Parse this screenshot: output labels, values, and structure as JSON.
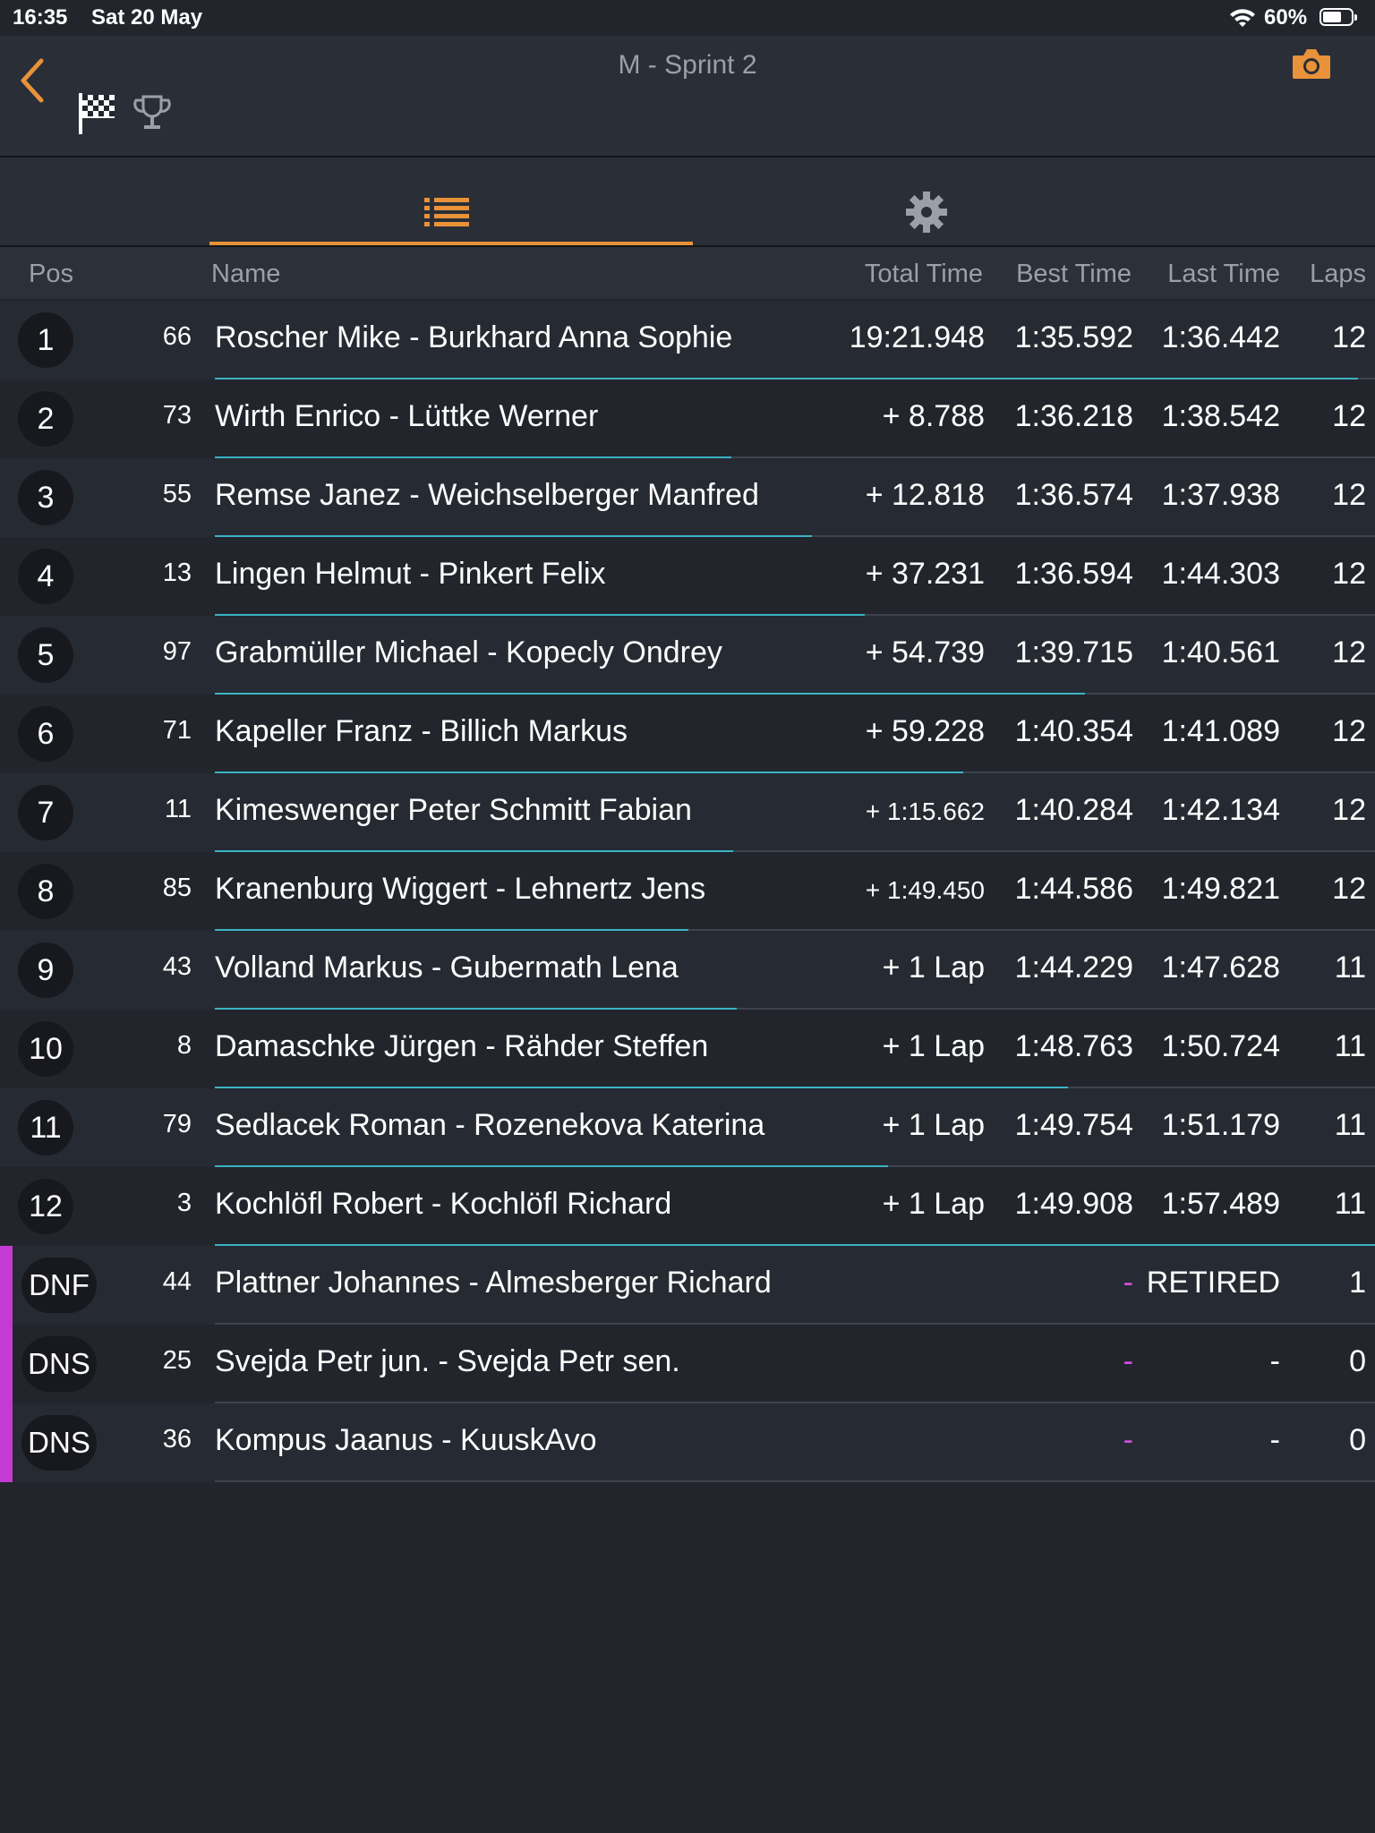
{
  "status": {
    "time": "16:35",
    "date": "Sat 20 May",
    "battery": "60%"
  },
  "nav": {
    "title": "M - Sprint 2"
  },
  "columns": {
    "pos": "Pos",
    "name": "Name",
    "total": "Total Time",
    "best": "Best Time",
    "last": "Last Time",
    "laps": "Laps"
  },
  "colors": {
    "accent": "#e8923a",
    "progress": "#3bb3c6",
    "retired": "#c43bd4"
  },
  "rows": [
    {
      "pos": "1",
      "num": "66",
      "name": "Roscher Mike - Burkhard Anna Sophie",
      "total": "19:21.948",
      "best": "1:35.592",
      "last": "1:36.442",
      "laps": "12",
      "progress": 0.985
    },
    {
      "pos": "2",
      "num": "73",
      "name": "Wirth  Enrico - Lüttke Werner",
      "total": "+ 8.788",
      "best": "1:36.218",
      "last": "1:38.542",
      "laps": "12",
      "progress": 0.445
    },
    {
      "pos": "3",
      "num": "55",
      "name": "Remse  Janez - Weichselberger Manfred",
      "total": "+ 12.818",
      "best": "1:36.574",
      "last": "1:37.938",
      "laps": "12",
      "progress": 0.515
    },
    {
      "pos": "4",
      "num": "13",
      "name": "Lingen  Helmut - Pinkert Felix",
      "total": "+ 37.231",
      "best": "1:36.594",
      "last": "1:44.303",
      "laps": "12",
      "progress": 0.56
    },
    {
      "pos": "5",
      "num": "97",
      "name": "Grabmüller  Michael - Kopecly Ondrey",
      "total": "+ 54.739",
      "best": "1:39.715",
      "last": "1:40.561",
      "laps": "12",
      "progress": 0.75
    },
    {
      "pos": "6",
      "num": "71",
      "name": "Kapeller  Franz - Billich Markus",
      "total": "+ 59.228",
      "best": "1:40.354",
      "last": "1:41.089",
      "laps": "12",
      "progress": 0.645
    },
    {
      "pos": "7",
      "num": "11",
      "name": "Kimeswenger Peter Schmitt Fabian",
      "total": "+ 1:15.662",
      "best": "1:40.284",
      "last": "1:42.134",
      "laps": "12",
      "progress": 0.447
    },
    {
      "pos": "8",
      "num": "85",
      "name": "Kranenburg Wiggert - Lehnertz Jens",
      "total": "+ 1:49.450",
      "best": "1:44.586",
      "last": "1:49.821",
      "laps": "12",
      "progress": 0.408
    },
    {
      "pos": "9",
      "num": "43",
      "name": "Volland Markus - Gubermath Lena",
      "total": "+ 1 Lap",
      "best": "1:44.229",
      "last": "1:47.628",
      "laps": "11",
      "progress": 0.45
    },
    {
      "pos": "10",
      "num": "8",
      "name": "Damaschke  Jürgen - Rähder Steffen",
      "total": "+ 1 Lap",
      "best": "1:48.763",
      "last": "1:50.724",
      "laps": "11",
      "progress": 0.735
    },
    {
      "pos": "11",
      "num": "79",
      "name": "Sedlacek  Roman - Rozenekova  Katerina",
      "total": "+ 1 Lap",
      "best": "1:49.754",
      "last": "1:51.179",
      "laps": "11",
      "progress": 0.58
    },
    {
      "pos": "12",
      "num": "3",
      "name": "Kochlöfl  Robert - Kochlöfl Richard",
      "total": "+ 1 Lap",
      "best": "1:49.908",
      "last": "1:57.489",
      "laps": "11",
      "progress": 1.0
    },
    {
      "pos": "DNF",
      "num": "44",
      "name": "Plattner Johannes - Almesberger Richard",
      "total": "",
      "best": "-",
      "last": "RETIRED",
      "laps": "1",
      "progress": 0
    },
    {
      "pos": "DNS",
      "num": "25",
      "name": "Svejda  Petr jun. - Svejda Petr sen.",
      "total": "",
      "best": "-",
      "last": "-",
      "laps": "0",
      "progress": 0
    },
    {
      "pos": "DNS",
      "num": "36",
      "name": "Kompus Jaanus - KuuskAvo",
      "total": "",
      "best": "-",
      "last": "-",
      "laps": "0",
      "progress": 0
    }
  ]
}
